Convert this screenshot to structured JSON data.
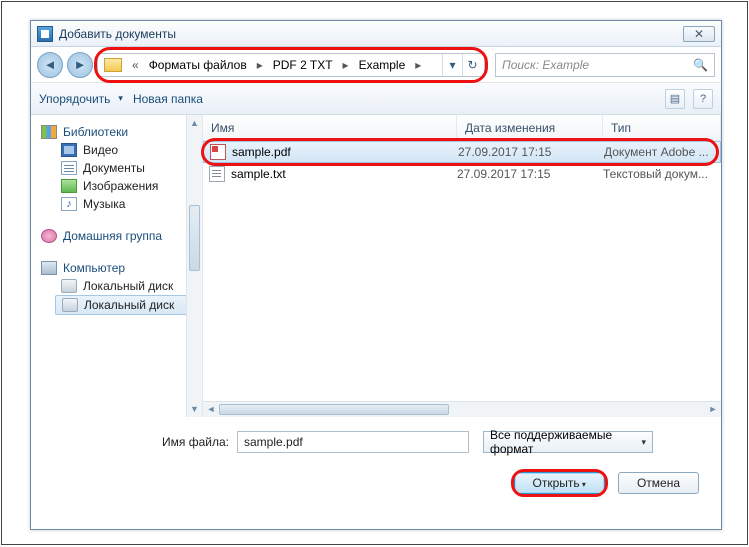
{
  "title": "Добавить документы",
  "breadcrumbs": {
    "b1": "Форматы файлов",
    "b2": "PDF 2 TXT",
    "b3": "Example"
  },
  "search": {
    "placeholder": "Поиск: Example"
  },
  "toolbar": {
    "organize": "Упорядочить",
    "newfolder": "Новая папка"
  },
  "sidebar": {
    "libraries": "Библиотеки",
    "video": "Видео",
    "documents": "Документы",
    "images": "Изображения",
    "music": "Музыка",
    "homegroup": "Домашняя группа",
    "computer": "Компьютер",
    "disk1": "Локальный диск",
    "disk2": "Локальный диск"
  },
  "columns": {
    "name": "Имя",
    "date": "Дата изменения",
    "type": "Тип"
  },
  "files": [
    {
      "name": "sample.pdf",
      "date": "27.09.2017 17:15",
      "type": "Документ Adobe ..."
    },
    {
      "name": "sample.txt",
      "date": "27.09.2017 17:15",
      "type": "Текстовый докум..."
    }
  ],
  "footer": {
    "filelabel": "Имя файла:",
    "filename": "sample.pdf",
    "filter": "Все поддерживаемые формат",
    "open": "Открыть",
    "cancel": "Отмена"
  }
}
